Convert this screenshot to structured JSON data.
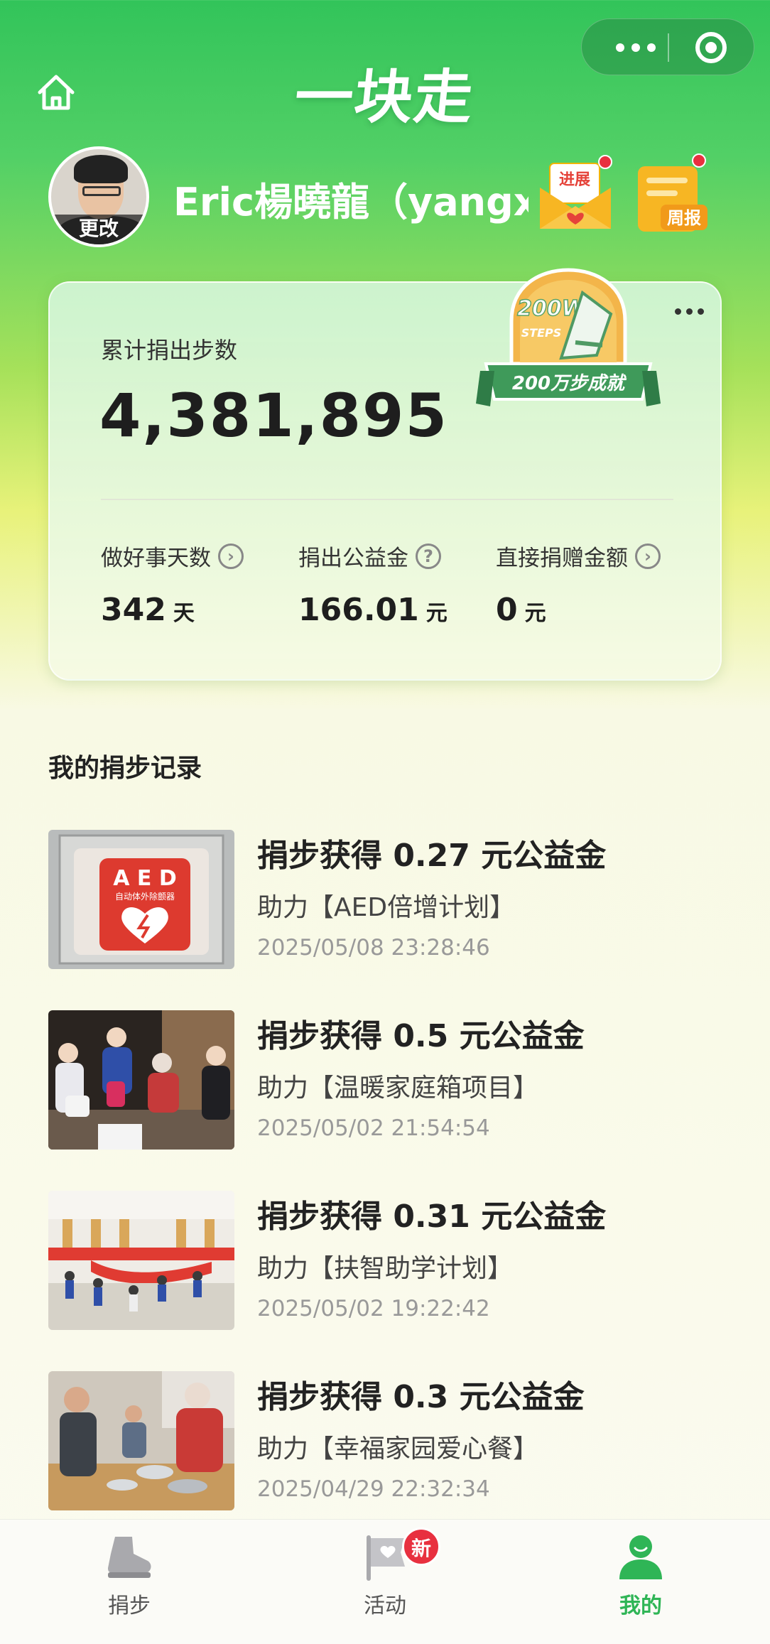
{
  "header": {
    "app_title": "一块走",
    "capsule_menu_icon": "more-dots-icon",
    "capsule_close_icon": "target-circle-icon"
  },
  "profile": {
    "username": "Eric楊曉龍（yangxi",
    "avatar_change_label": "更改",
    "envelope_label": "进展",
    "report_label": "周报"
  },
  "summary": {
    "total_label": "累计捐出步数",
    "total_value": "4,381,895",
    "badge_top": "200W",
    "badge_steps": "STEPS",
    "badge_ribbon": "200万步成就",
    "stats": [
      {
        "label": "做好事天数",
        "value": "342",
        "unit": "天"
      },
      {
        "label": "捐出公益金",
        "value": "166.01",
        "unit": "元"
      },
      {
        "label": "直接捐赠金额",
        "value": "0",
        "unit": "元"
      }
    ]
  },
  "records_title": "我的捐步记录",
  "records": [
    {
      "title": "捐步获得 0.27 元公益金",
      "project": "助力【AED倍增计划】",
      "time": "2025/05/08 23:28:46",
      "thumb_caption": "A E D",
      "thumb_sub": "自动体外除颤器"
    },
    {
      "title": "捐步获得 0.5 元公益金",
      "project": "助力【温暖家庭箱项目】",
      "time": "2025/05/02 21:54:54"
    },
    {
      "title": "捐步获得 0.31 元公益金",
      "project": "助力【扶智助学计划】",
      "time": "2025/05/02 19:22:42"
    },
    {
      "title": "捐步获得 0.3 元公益金",
      "project": "助力【幸福家园爱心餐】",
      "time": "2025/04/29 22:32:34"
    }
  ],
  "tabbar": {
    "tabs": [
      {
        "label": "捐步",
        "icon": "shoe-icon"
      },
      {
        "label": "活动",
        "icon": "flag-icon"
      },
      {
        "label": "我的",
        "icon": "person-icon"
      }
    ],
    "new_badge": "新",
    "active_index": 2
  },
  "colors": {
    "brand_green": "#2fb556",
    "header_green": "#32c45a",
    "badge_red": "#e8303f"
  }
}
